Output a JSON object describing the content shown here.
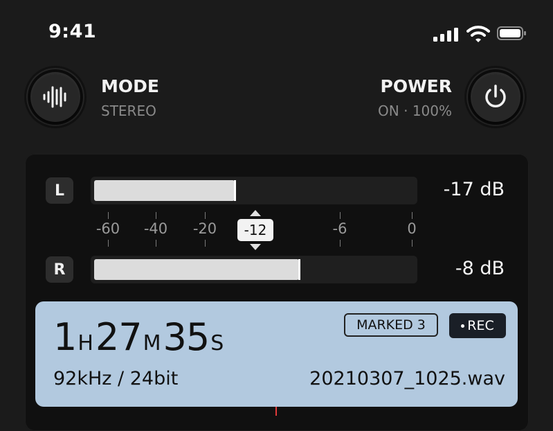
{
  "status_bar": {
    "time": "9:41"
  },
  "mode": {
    "title": "MODE",
    "value": "STEREO"
  },
  "power": {
    "title": "POWER",
    "value": "ON · 100%"
  },
  "meters": {
    "left": {
      "badge": "L",
      "level_db": "-17 dB",
      "fill_fraction": 0.44
    },
    "right": {
      "badge": "R",
      "level_db": "-8 dB",
      "fill_fraction": 0.64
    },
    "scale": [
      "-60",
      "-40",
      "-20",
      "-6",
      "0"
    ],
    "marker": "-12"
  },
  "recording": {
    "hours": "1",
    "hours_unit": "H",
    "minutes": "27",
    "minutes_unit": "M",
    "seconds": "35",
    "seconds_unit": "S",
    "marked_label": "MARKED 3",
    "rec_label": "REC",
    "format": "92kHz / 24bit",
    "filename": "20210307_1025.wav"
  },
  "colors": {
    "card": "#b2c9df",
    "background": "#1b1b1b",
    "playhead": "#e23b3b"
  }
}
